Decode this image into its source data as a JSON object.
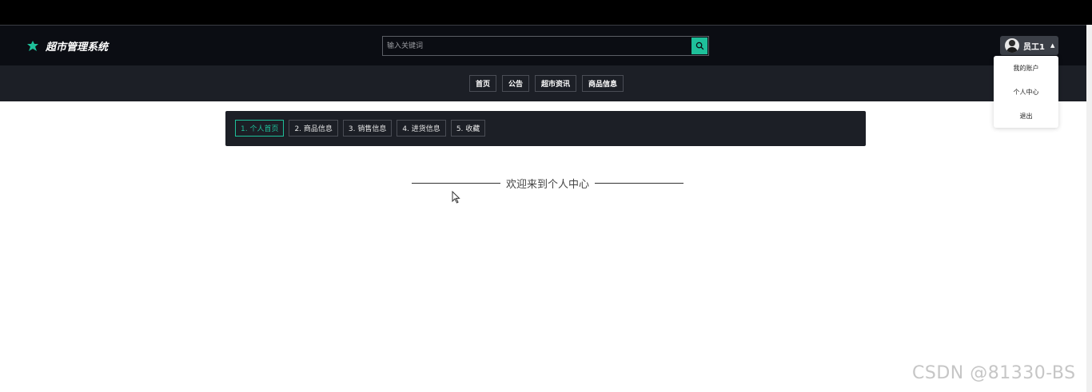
{
  "app": {
    "title": "超市管理系统"
  },
  "search": {
    "placeholder": "输入关键词"
  },
  "user": {
    "name": "员工1"
  },
  "nav": {
    "items": [
      "首页",
      "公告",
      "超市资讯",
      "商品信息"
    ]
  },
  "dropdown": {
    "items": [
      "我的账户",
      "个人中心",
      "退出"
    ]
  },
  "tabs": {
    "items": [
      "1. 个人首页",
      "2. 商品信息",
      "3. 销售信息",
      "4. 进货信息",
      "5. 收藏"
    ],
    "active": 0
  },
  "welcome": {
    "text": "欢迎来到个人中心"
  },
  "watermark": {
    "text": "CSDN @81330-BS"
  },
  "colors": {
    "accent": "#1ec09a",
    "header_bg": "#0b0d13",
    "nav_bg": "#1c1f26"
  }
}
